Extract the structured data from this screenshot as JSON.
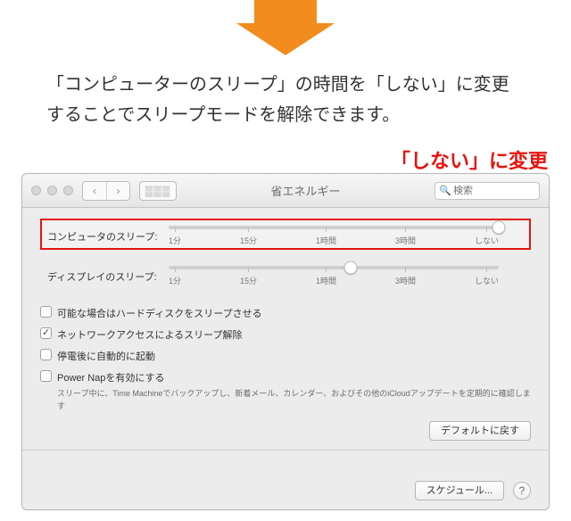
{
  "instruction": "「コンピューターのスリープ」の時間を「しない」に変更することでスリープモードを解除できます。",
  "callout": "「しない」に変更",
  "window": {
    "title": "省エネルギー",
    "search_placeholder": "検索",
    "restore_defaults": "デフォルトに戻す",
    "schedule": "スケジュール...",
    "help": "?"
  },
  "sliders": {
    "ticks": [
      "1分",
      "15分",
      "1時間",
      "3時間",
      "しない"
    ],
    "computer": {
      "label": "コンピュータのスリープ:",
      "position_pct": 100
    },
    "display": {
      "label": "ディスプレイのスリープ:",
      "position_pct": 55
    }
  },
  "checkboxes": [
    {
      "label": "可能な場合はハードディスクをスリープさせる",
      "checked": false
    },
    {
      "label": "ネットワークアクセスによるスリープ解除",
      "checked": true
    },
    {
      "label": "停電後に自動的に起動",
      "checked": false
    },
    {
      "label": "Power Napを有効にする",
      "checked": false,
      "description": "スリープ中に、Time Machineでバックアップし、新着メール、カレンダー、およびその他のiCloudアップデートを定期的に確認します"
    }
  ]
}
